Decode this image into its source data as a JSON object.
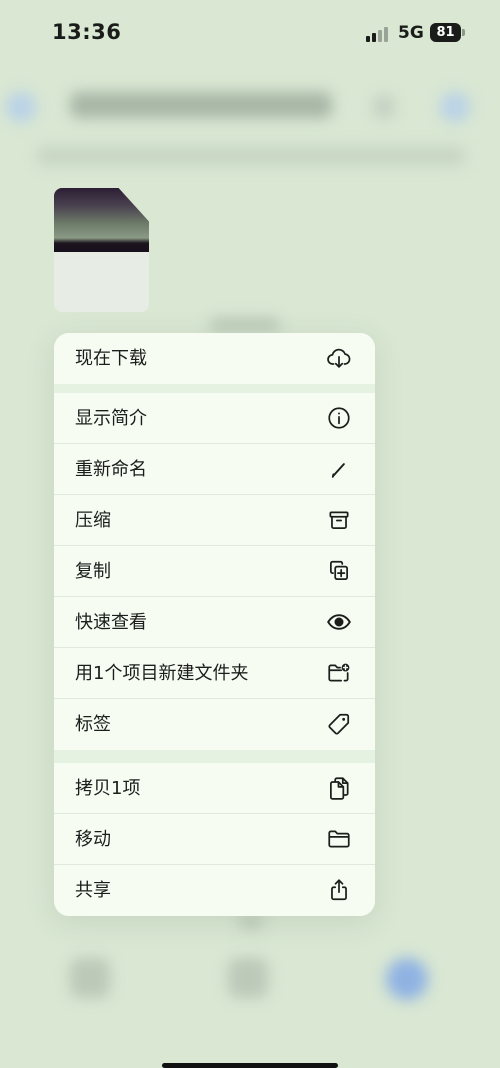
{
  "status_bar": {
    "time": "13:36",
    "network": "5G",
    "battery": "81"
  },
  "menu": {
    "groups": [
      {
        "items": [
          {
            "label": "现在下载",
            "icon": "cloud-download-icon"
          }
        ]
      },
      {
        "items": [
          {
            "label": "显示简介",
            "icon": "info-icon"
          },
          {
            "label": "重新命名",
            "icon": "pencil-icon"
          },
          {
            "label": "压缩",
            "icon": "archive-box-icon"
          },
          {
            "label": "复制",
            "icon": "duplicate-icon"
          },
          {
            "label": "快速查看",
            "icon": "eye-icon"
          },
          {
            "label": "用1个项目新建文件夹",
            "icon": "folder-add-icon"
          },
          {
            "label": "标签",
            "icon": "tag-icon"
          }
        ]
      },
      {
        "items": [
          {
            "label": "拷贝1项",
            "icon": "copy-documents-icon"
          },
          {
            "label": "移动",
            "icon": "folder-icon"
          },
          {
            "label": "共享",
            "icon": "share-icon"
          }
        ]
      }
    ]
  },
  "colors": {
    "background": "#d9e7d3",
    "menu_surface": "#f6fcf2",
    "menu_separator": "#e6f2e1",
    "text": "#1c1e1c"
  }
}
